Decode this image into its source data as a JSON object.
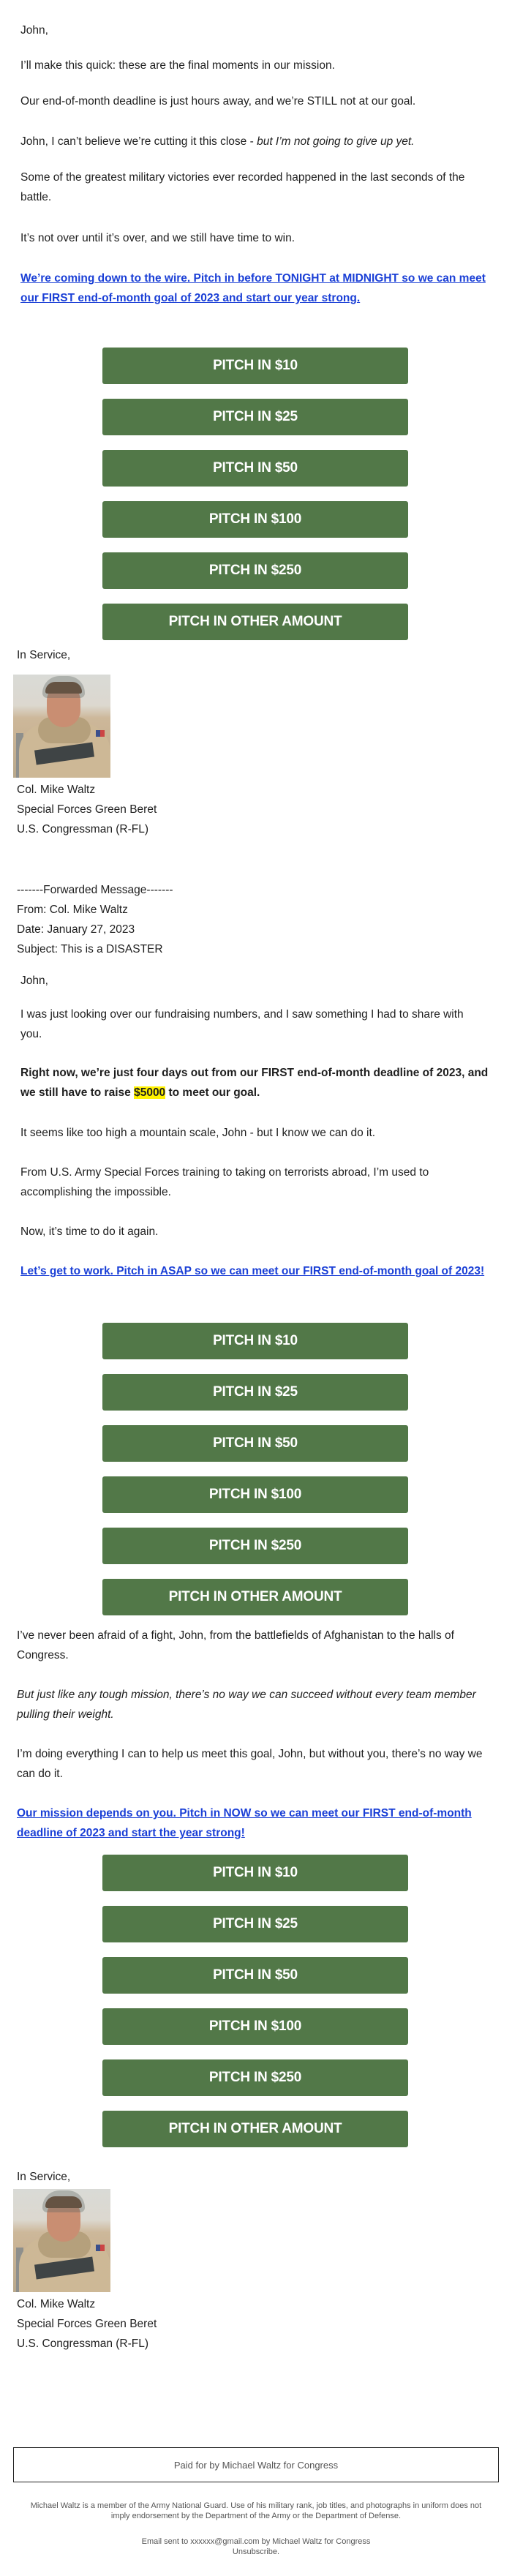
{
  "colors": {
    "button_bg": "#527848",
    "button_text": "#ffffff",
    "link": "#1a3fd6",
    "highlight": "#fff200",
    "text": "#1e1e1e",
    "footer_text": "#555555"
  },
  "section1": {
    "greeting": "John,",
    "p1": "I’ll make this quick: these are the final moments in our mission.",
    "p2": "Our end-of-month deadline is just hours away, and we’re STILL not at our goal.",
    "p3_plain": "John, I can’t believe we’re cutting it this close - ",
    "p3_italic": "but I’m not going to give up yet.",
    "p4": "Some of the greatest military victories ever recorded happened in the last seconds of the battle.",
    "p5": "It’s not over until it’s over, and we still have time to win.",
    "cta": "We’re coming down to the wire. Pitch in before TONIGHT at MIDNIGHT so we can meet our FIRST end-of-month goal of 2023 and start our year strong."
  },
  "buttons": [
    "PITCH IN $10",
    "PITCH IN $25",
    "PITCH IN $50",
    "PITCH IN $100",
    "PITCH IN $250",
    "PITCH IN OTHER AMOUNT"
  ],
  "signature": {
    "closing": "In Service,",
    "photo_alt": "Photo of Col. Mike Waltz in desert military gear",
    "name": "Col. Mike Waltz",
    "title1": "Special Forces Green Beret",
    "title2": "U.S. Congressman (R-FL)"
  },
  "forwarded": {
    "divider": "-------Forwarded Message-------",
    "from": "From: Col. Mike Waltz",
    "date": "Date: January 27, 2023",
    "subject": "Subject: This is a DISASTER"
  },
  "section2": {
    "greeting": "John,",
    "p1": "I was just looking over our fundraising numbers, and I saw something I had to share with you.",
    "p2_before": "Right now, we’re just four days out from our FIRST end-of-month deadline of 2023, and we still have to raise ",
    "p2_highlight": "$5000",
    "p2_after": " to meet our goal.",
    "p3": "It seems like too high a mountain scale, John - but I know we can do it.",
    "p4": "From U.S. Army Special Forces training to taking on terrorists abroad, I’m used to accomplishing the impossible.",
    "p5": "Now, it’s time to do it again.",
    "cta": "Let’s get to work. Pitch in ASAP so we can meet our FIRST end-of-month goal of 2023!"
  },
  "section3": {
    "p1": "I’ve never been afraid of a fight, John, from the battlefields of Afghanistan to the halls of Congress.",
    "p2": "But just like any tough mission, there’s no way we can succeed without every team member pulling their weight.",
    "p3": "I’m doing everything I can to help us meet this goal, John, but without you, there’s no way we can do it.",
    "cta": "Our mission depends on you. Pitch in NOW so we can meet our FIRST end-of-month deadline of 2023 and start the year strong!"
  },
  "footer": {
    "paid_for": "Paid for by Michael Waltz for Congress",
    "disclaimer": "Michael Waltz is a member of the Army National Guard. Use of his military rank, job titles, and photographs in uniform does not imply endorsement by the Department of the Army or the Department of Defense.",
    "sent_to": "Email sent to xxxxxx@gmail.com by Michael Waltz for Congress",
    "unsubscribe": "Unsubscribe."
  }
}
